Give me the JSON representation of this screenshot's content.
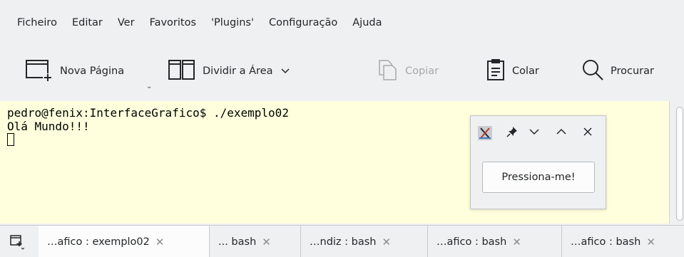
{
  "menubar": {
    "items": [
      "Ficheiro",
      "Editar",
      "Ver",
      "Favoritos",
      "'Plugins'",
      "Configuração",
      "Ajuda"
    ]
  },
  "toolbar": {
    "new_page": "Nova Página",
    "split_view": "Dividir a Área",
    "copy": "Copiar",
    "paste": "Colar",
    "find": "Procurar"
  },
  "terminal": {
    "lines": [
      "pedro@fenix:InterfaceGrafico$ ./exemplo02",
      "Olá Mundo!!!"
    ]
  },
  "popup": {
    "button_label": "Pressiona-me!"
  },
  "tabs": [
    {
      "label": "…afico : exemplo02",
      "active": true
    },
    {
      "label": "... bash",
      "active": false
    },
    {
      "label": "…ndiz : bash",
      "active": false
    },
    {
      "label": "…afico : bash",
      "active": false
    },
    {
      "label": "…afico : bash",
      "active": false
    }
  ],
  "colors": {
    "terminal_bg": "#ffffdd",
    "window_bg": "#eff0f1"
  }
}
